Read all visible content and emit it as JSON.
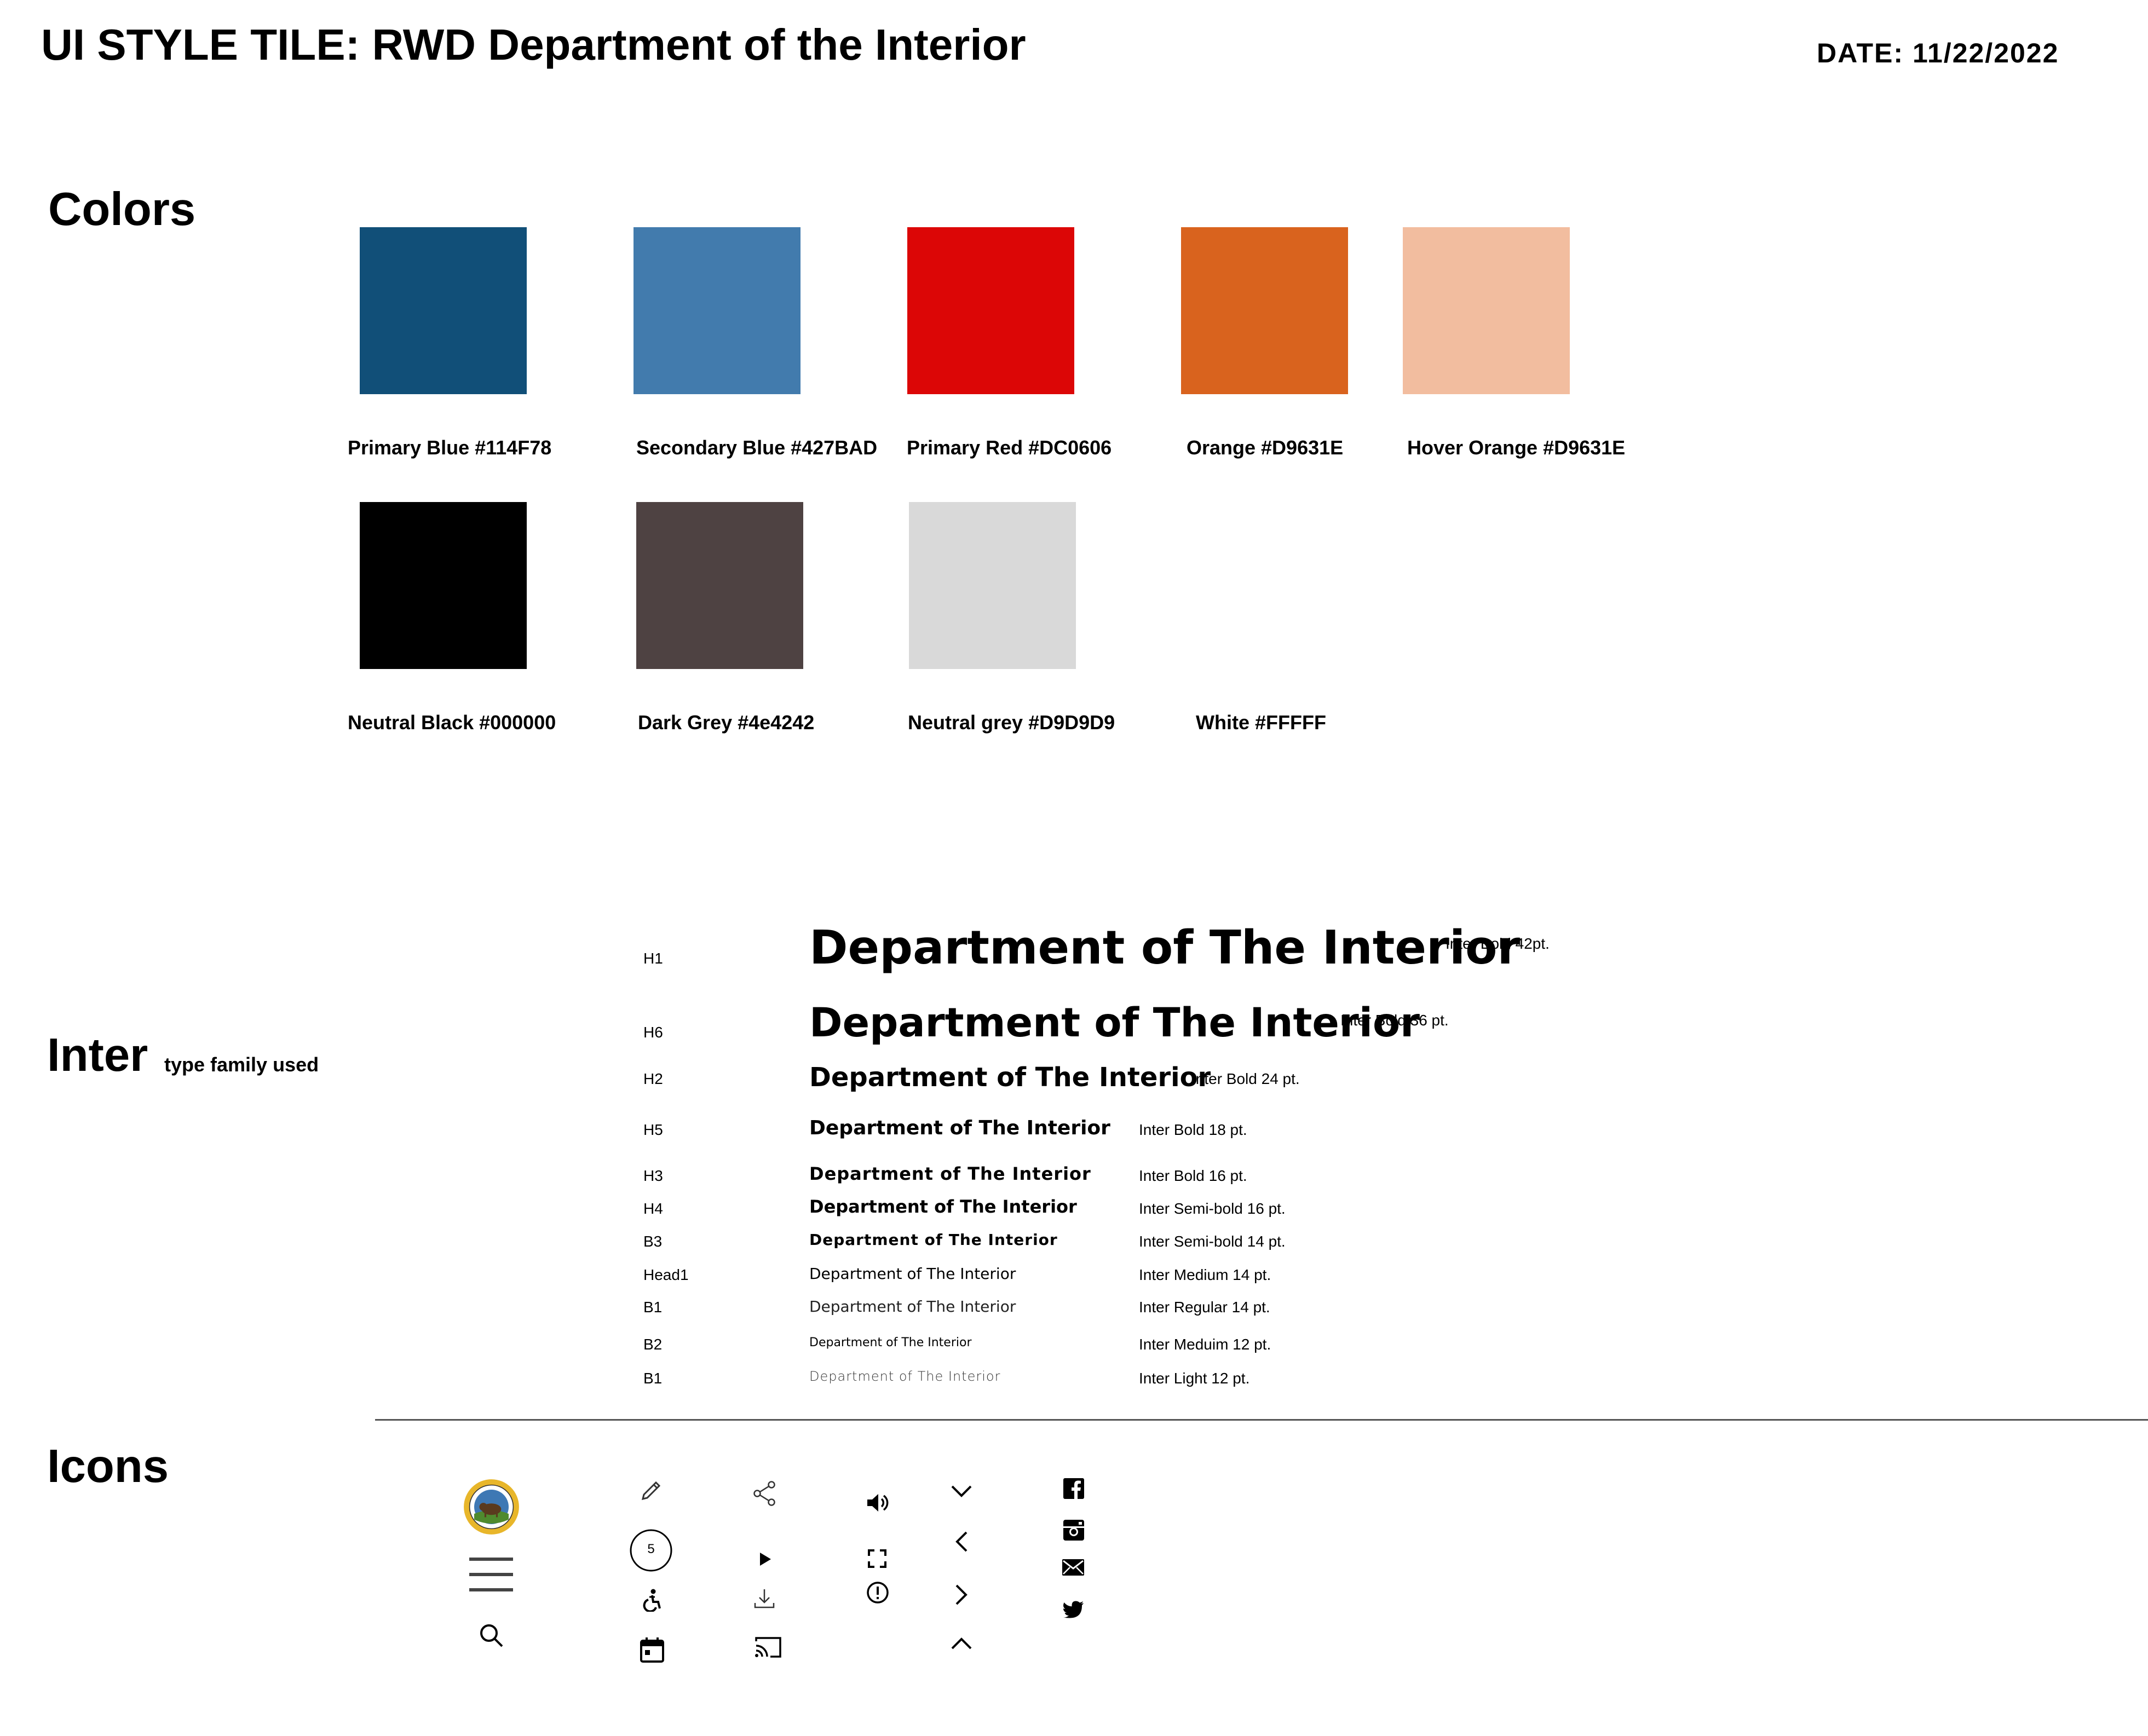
{
  "header": {
    "title": "UI STYLE TILE: RWD Department of the Interior",
    "date": "DATE: 11/22/2022"
  },
  "colors_section": {
    "heading": "Colors",
    "swatches": [
      {
        "label": "Primary Blue #114F78",
        "color": "#114F78"
      },
      {
        "label": "Secondary Blue #427BAD",
        "color": "#427BAD"
      },
      {
        "label": "Primary Red #DC0606",
        "color": "#DC0606"
      },
      {
        "label": "Orange #D9631E",
        "color": "#D9631E"
      },
      {
        "label": "Hover Orange #D9631E",
        "color": "#F2BD9F"
      },
      {
        "label": "Neutral Black #000000",
        "color": "#000000"
      },
      {
        "label": "Dark Grey #4e4242",
        "color": "#4E4242"
      },
      {
        "label": "Neutral grey #D9D9D9",
        "color": "#D9D9D9"
      },
      {
        "label": "White #FFFFF",
        "color": "#FFFFFF"
      }
    ]
  },
  "type_section": {
    "heading": "Inter",
    "subheading": "type family  used",
    "rows": [
      {
        "key": "H1",
        "sample": "Department of The Interior",
        "spec": "Inter Bold 42pt."
      },
      {
        "key": "H6",
        "sample": "Department of The Interior",
        "spec": "Inter Bold 36 pt."
      },
      {
        "key": "H2",
        "sample": "Department of The Interior",
        "spec": "Inter Bold 24 pt."
      },
      {
        "key": "H5",
        "sample": "Department of The Interior",
        "spec": "Inter Bold 18 pt."
      },
      {
        "key": "H3",
        "sample": "Department of The Interior",
        "spec": "Inter Bold 16 pt."
      },
      {
        "key": "H4",
        "sample": "Department of The Interior",
        "spec": "Inter Semi-bold 16 pt."
      },
      {
        "key": "B3",
        "sample": "Department of The Interior",
        "spec": "Inter Semi-bold 14 pt."
      },
      {
        "key": "Head1",
        "sample": "Department of The Interior",
        "spec": "Inter Medium 14 pt."
      },
      {
        "key": "B1",
        "sample": "Department of The Interior",
        "spec": "Inter Regular 14 pt."
      },
      {
        "key": "B2",
        "sample": "Department of The Interior",
        "spec": "Inter Meduim 12 pt."
      },
      {
        "key": "B1",
        "sample": "Department of The Interior",
        "spec": "Inter Light 12 pt."
      }
    ]
  },
  "icons_section": {
    "heading": "Icons",
    "icons": [
      "seal-logo",
      "hamburger-menu-icon",
      "search-icon",
      "pencil-icon",
      "numbered-circle-icon",
      "accessibility-icon",
      "calendar-icon",
      "share-icon",
      "play-icon",
      "download-icon",
      "cast-icon",
      "volume-icon",
      "fullscreen-icon",
      "alert-circle-icon",
      "chevron-down-icon",
      "chevron-left-icon",
      "chevron-right-icon",
      "chevron-up-icon",
      "facebook-icon",
      "instagram-icon",
      "email-icon",
      "twitter-icon"
    ],
    "badge_number": "5"
  }
}
